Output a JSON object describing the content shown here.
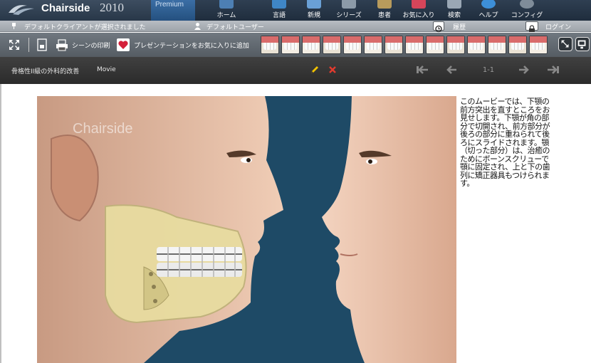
{
  "app": {
    "name": "Chairside",
    "year": "2010",
    "edition": "Premium",
    "watermark": "Chairside"
  },
  "nav": [
    {
      "label": "ホーム",
      "icon": "home-icon",
      "color": "#4d7fb3"
    },
    {
      "label": "言語",
      "icon": "language-icon",
      "color": "#3f86c6"
    },
    {
      "label": "新規",
      "icon": "new-icon",
      "color": "#6aa0d6"
    },
    {
      "label": "シリーズ",
      "icon": "series-icon",
      "color": "#8c9aa8"
    },
    {
      "label": "患者",
      "icon": "patient-icon",
      "color": "#b89b5c"
    },
    {
      "label": "お気に入り",
      "icon": "favorites-icon",
      "color": "#d6455a"
    },
    {
      "label": "検索",
      "icon": "search-icon",
      "color": "#9aa7b5"
    },
    {
      "label": "ヘルプ",
      "icon": "help-icon",
      "color": "#3d8fd8"
    },
    {
      "label": "コンフィグ",
      "icon": "config-icon",
      "color": "#7f8c99"
    }
  ],
  "status": {
    "client": "デフォルトクライアントが選択されました",
    "user": "デフォルトユーザー",
    "history": "履歴",
    "login": "ログイン"
  },
  "toolbar": {
    "print_scene": "シーンの印刷",
    "add_presentation": "プレゼンテーションをお気に入りに追加",
    "thumb_count": 14
  },
  "titlebar": {
    "title": "骨格性II級の外科的改善",
    "tag": "Movie",
    "counter": "1-1",
    "edit_color": "#f2c200",
    "delete_color": "#e23b2e"
  },
  "content": {
    "description": "このムービーでは、下顎の前方突出を直すところをお見せします。下顎が角の部分で切開され、前方部分が後ろの部分に重ねられて後ろにスライドされます。顎（切った部分）は、治癒のためにボーンスクリューで顎に固定され、上と下の歯列に矯正器具もつけられます。"
  }
}
